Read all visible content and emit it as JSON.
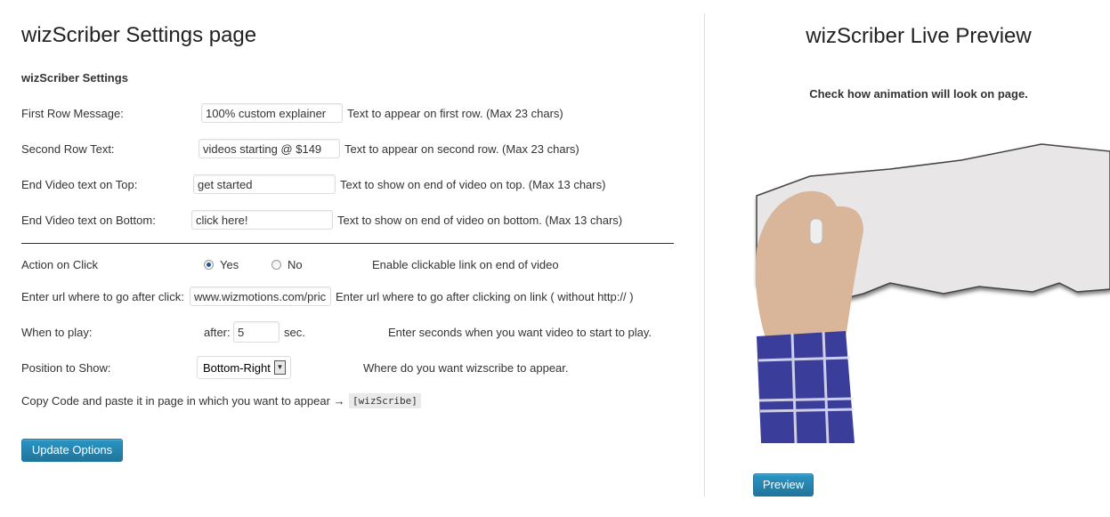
{
  "settings": {
    "title": "wizScriber Settings page",
    "section": "wizScriber Settings",
    "rows": [
      {
        "label": "First Row Message:",
        "value": "100% custom explainer",
        "help": "Text to appear on first row. (Max 23 chars)"
      },
      {
        "label": "Second Row Text:",
        "value": "videos starting @ $149",
        "help": "Text to appear on second row. (Max 23 chars)"
      },
      {
        "label": "End Video text on Top:",
        "value": "get started",
        "help": "Text to show on end of video on top. (Max 13 chars)"
      },
      {
        "label": "End Video text on Bottom:",
        "value": "click here!",
        "help": "Text to show on end of video on bottom. (Max 13 chars)"
      }
    ],
    "action": {
      "label": "Action on Click",
      "yes": "Yes",
      "no": "No",
      "selected": "Yes",
      "help": "Enable clickable link on end of video"
    },
    "url": {
      "label": "Enter url where to go after click:",
      "value": "www.wizmotions.com/pricing",
      "help": "Enter url where to go after clicking on link ( without http:// )"
    },
    "play": {
      "label": "When to play:",
      "prefix": "after:",
      "value": "5",
      "suffix": "sec.",
      "help": "Enter seconds when you want video to start to play."
    },
    "position": {
      "label": "Position to Show:",
      "value": "Bottom-Right",
      "help": "Where do you want wizscribe to appear."
    },
    "code": {
      "label": "Copy Code and paste it in page in which you want to appear →",
      "shortcode": "[wizScribe]"
    },
    "update_label": "Update Options"
  },
  "preview": {
    "title": "wizScriber Live Preview",
    "subtitle": "Check how animation will look on page.",
    "button": "Preview"
  },
  "colors": {
    "accent": "#21759b"
  }
}
